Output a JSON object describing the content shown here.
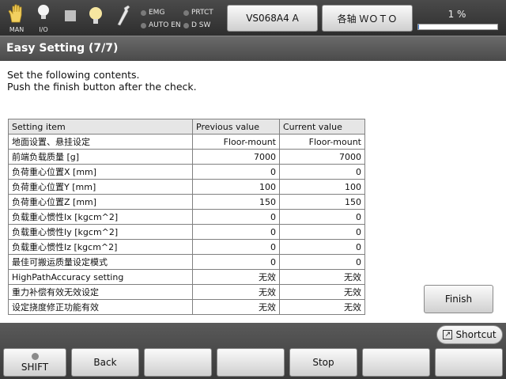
{
  "topbar": {
    "mode_label": "MAN",
    "io_label": "I/O",
    "indicators": {
      "emg": "EMG",
      "prtct": "PRTCT",
      "auto_en": "AUTO EN",
      "dsw": "D SW"
    },
    "robot_model": "VS068A4 A",
    "axis_label": "各轴 ＷＯＴＯ",
    "progress_text": "1 %",
    "progress_percent": 1,
    "icons": [
      "hand-icon",
      "lightbulb-icon",
      "stop-square-icon",
      "lamp-icon",
      "wrench-icon"
    ]
  },
  "title": "Easy Setting (7/7)",
  "instructions": {
    "line1": "Set the following contents.",
    "line2": "Push the finish button after the check."
  },
  "table": {
    "headers": {
      "item": "Setting item",
      "previous": "Previous value",
      "current": "Current value"
    },
    "rows": [
      {
        "item": "地面设置、悬挂设定",
        "previous": "Floor-mount",
        "current": "Floor-mount"
      },
      {
        "item": "前端负载质量 [g]",
        "previous": "7000",
        "current": "7000"
      },
      {
        "item": "负荷重心位置X [mm]",
        "previous": "0",
        "current": "0"
      },
      {
        "item": "负荷重心位置Y [mm]",
        "previous": "100",
        "current": "100"
      },
      {
        "item": "负荷重心位置Z [mm]",
        "previous": "150",
        "current": "150"
      },
      {
        "item": "负载重心惯性Ix [kgcm^2]",
        "previous": "0",
        "current": "0"
      },
      {
        "item": "负载重心惯性Iy [kgcm^2]",
        "previous": "0",
        "current": "0"
      },
      {
        "item": "负载重心惯性Iz [kgcm^2]",
        "previous": "0",
        "current": "0"
      },
      {
        "item": "最佳可搬运质量设定模式",
        "previous": "0",
        "current": "0"
      },
      {
        "item": "HighPathAccuracy setting",
        "previous": "无效",
        "current": "无效"
      },
      {
        "item": "重力补偿有效无效设定",
        "previous": "无效",
        "current": "无效"
      },
      {
        "item": "设定挠度修正功能有效",
        "previous": "无效",
        "current": "无效"
      }
    ]
  },
  "finish_label": "Finish",
  "shortcut_label": "Shortcut",
  "function_keys": {
    "shift": "SHIFT",
    "back": "Back",
    "f3": "",
    "f4": "",
    "stop": "Stop",
    "f6": "",
    "f7": ""
  },
  "colors": {
    "accent": "#3a7ad0",
    "icon_yellow": "#f2d060"
  }
}
